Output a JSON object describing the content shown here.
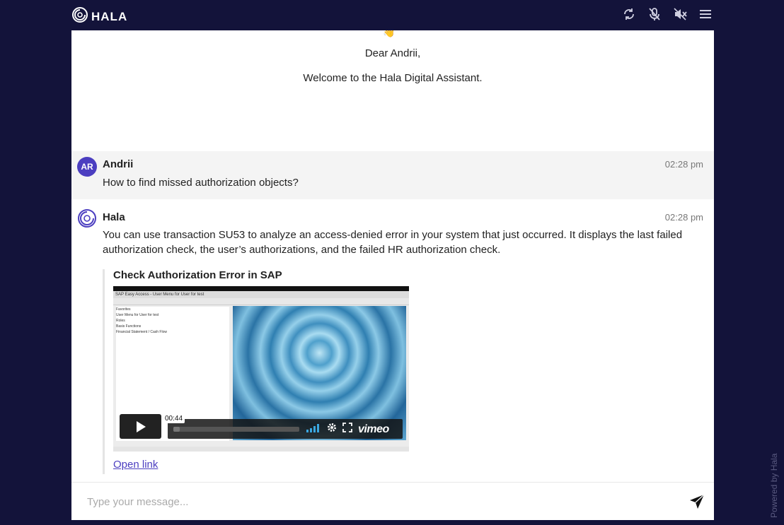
{
  "brand": {
    "name": "HALA"
  },
  "topbar": {
    "icons": [
      "refresh-icon",
      "mic-off-icon",
      "sound-off-icon",
      "menu-icon"
    ]
  },
  "welcome": {
    "greeting": "Dear Andrii,",
    "intro": "Welcome to the Hala Digital Assistant."
  },
  "messages": [
    {
      "avatar": "AR",
      "sender": "Andrii",
      "time": "02:28 pm",
      "text": "How to find missed authorization objects?"
    },
    {
      "sender": "Hala",
      "time": "02:28 pm",
      "text": "You can use transaction SU53 to analyze an access-denied error in your system that just occurred. It displays the last failed authorization check, the user’s authorizations, and the failed HR authorization check.",
      "card": {
        "title": "Check Authorization Error in SAP",
        "video": {
          "window_title": "SAP Easy Access - User Menu for User for test",
          "tree": [
            "Favorites",
            "User Menu for User for test",
            "Roles",
            "Basis Functions",
            "Financial Statement / Cash Flow"
          ],
          "time": "00:44",
          "progress": 0.05,
          "brand": "vimeo"
        },
        "link_label": "Open link"
      }
    }
  ],
  "composer": {
    "placeholder": "Type your message..."
  },
  "footer": {
    "powered_by": "Powered by Hala"
  },
  "colors": {
    "background": "#13133a",
    "accent": "#4b3ec0"
  }
}
